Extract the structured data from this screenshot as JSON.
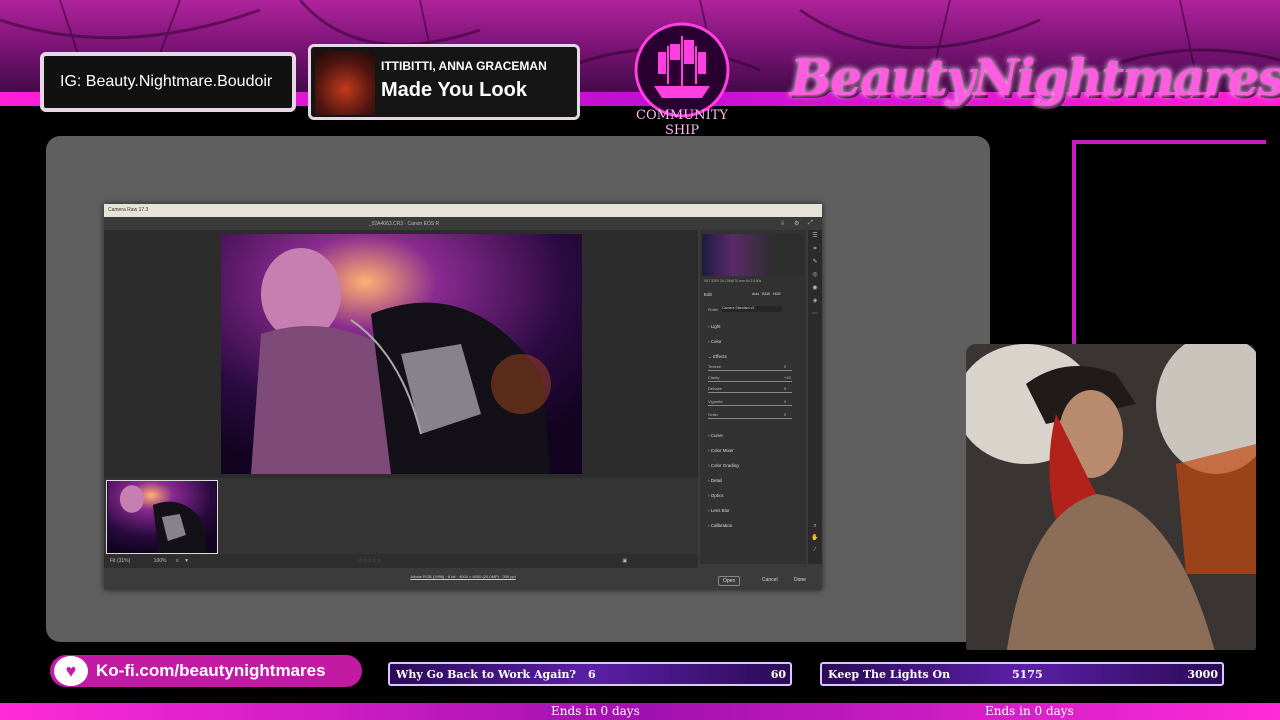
{
  "overlay": {
    "ig_handle": "IG: Beauty.Nightmare.Boudoir",
    "now_playing": {
      "artist": "ITTIBITTI, ANNA GRACEMAN",
      "track": "Made You Look"
    },
    "community_label": "COMMUNITY SHIP",
    "brand": "BeautyNightmares",
    "kofi": "Ko-fi.com/beautynightmares",
    "goals": [
      {
        "name": "Why Go Back to Work Again?",
        "current": "6",
        "target": "60",
        "ends": "Ends in 0 days"
      },
      {
        "name": "Keep The Lights On",
        "current": "5175",
        "target": "3000",
        "ends": "Ends in 0 days"
      }
    ]
  },
  "camera_raw": {
    "window_title": "Camera Raw 17.3",
    "file_label": "_02A4063.CR3  ·  Canon EOS R",
    "zoom": "Fit (31%)",
    "zoom_pct": "100%",
    "image_info": "Adobe RGB (1998) · 8 bit · 4000 × 6000 (24.0MP) · 300 ppi",
    "histogram_readout": "ISO 3200   24-105@70 mm   f/4   1/160s",
    "edit_label": "Edit",
    "profile_label": "Profile",
    "profile_value": "Camera Standard v2",
    "auto_buttons": [
      "Auto",
      "B&W",
      "HDR"
    ],
    "sections": [
      "Light",
      "Color",
      "Effects",
      "Curve",
      "Color Mixer",
      "Color Grading",
      "Detail",
      "Optics",
      "Lens Blur",
      "Calibration"
    ],
    "effects_sliders": [
      {
        "label": "Texture",
        "value": "0"
      },
      {
        "label": "Clarity",
        "value": "+15"
      },
      {
        "label": "Dehaze",
        "value": "0"
      },
      {
        "label": "Vignette",
        "value": "0"
      },
      {
        "label": "Grain",
        "value": "0"
      }
    ],
    "buttons": {
      "open": "Open",
      "cancel": "Cancel",
      "done": "Done"
    }
  }
}
